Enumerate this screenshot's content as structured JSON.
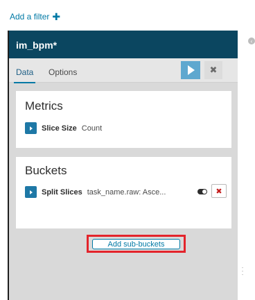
{
  "filter_bar": {
    "add_filter_label": "Add a filter",
    "add_icon_glyph": "✚"
  },
  "sidebar": {
    "title": "im_bpm*",
    "tabs": [
      {
        "label": "Data",
        "active": true
      },
      {
        "label": "Options",
        "active": false
      }
    ],
    "apply_icon": "play-icon",
    "discard_glyph": "✖"
  },
  "metrics": {
    "heading": "Metrics",
    "items": [
      {
        "label": "Slice Size",
        "description": "Count"
      }
    ]
  },
  "buckets": {
    "heading": "Buckets",
    "items": [
      {
        "label": "Split Slices",
        "description": "task_name.raw: Asce...",
        "remove_glyph": "✖"
      }
    ],
    "add_sub_buckets_label": "Add sub-buckets"
  },
  "colors": {
    "sidebar_title_bg": "#0b4660",
    "accent": "#0079a5",
    "apply_button": "#5fa8cf",
    "highlight": "#e3242b",
    "remove": "#c41e1e"
  }
}
